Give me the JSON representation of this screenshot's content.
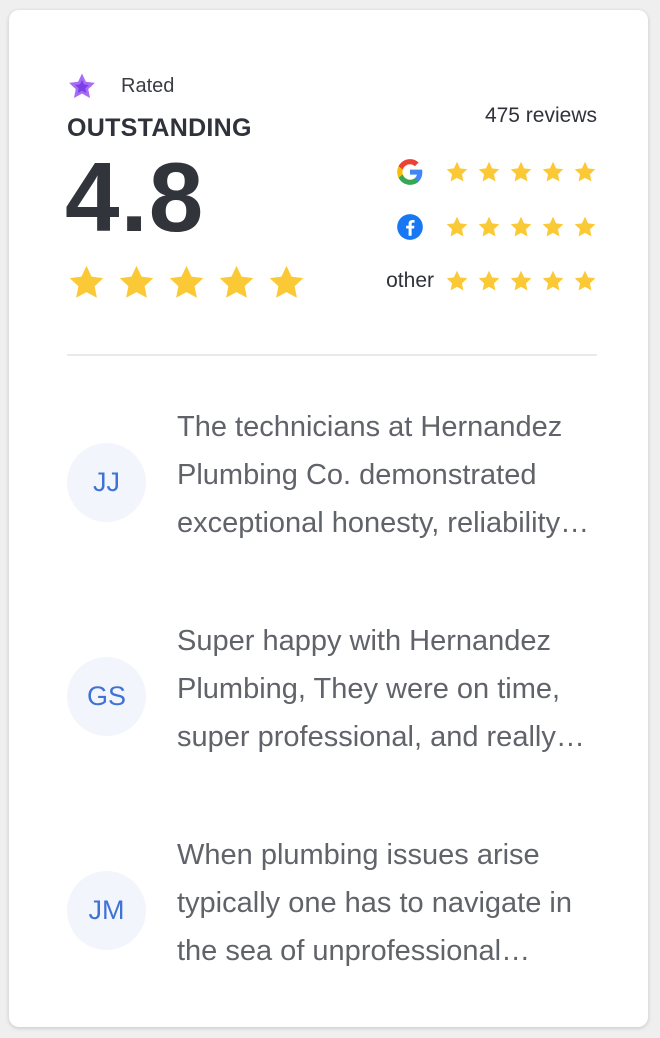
{
  "widget": {
    "rated_label": "Rated",
    "rating_word": "OUTSTANDING",
    "score": "4.8",
    "total_reviews": "475 reviews",
    "star_rating": 5,
    "colors": {
      "star": "#fbc935",
      "brand": "#9b59f5",
      "avatar_text": "#3f72d6"
    },
    "sources": [
      {
        "name": "google",
        "icon": "google-icon",
        "stars": 5
      },
      {
        "name": "facebook",
        "icon": "facebook-icon",
        "stars": 5
      },
      {
        "name": "other",
        "label": "other",
        "stars": 5
      }
    ]
  },
  "reviews": [
    {
      "initials": "JJ",
      "text": "The technicians at Hernandez Plumbing Co. demonstrated exceptional honesty, reliability and professionalism throughout the entire job."
    },
    {
      "initials": "GS",
      "text": "Super happy with Hernandez Plumbing, They were on time, super professional, and really knew what they were doing."
    },
    {
      "initials": "JM",
      "text": "When plumbing issues arise typically one has to navigate in the sea of unprofessional plumbers and contractors."
    }
  ]
}
